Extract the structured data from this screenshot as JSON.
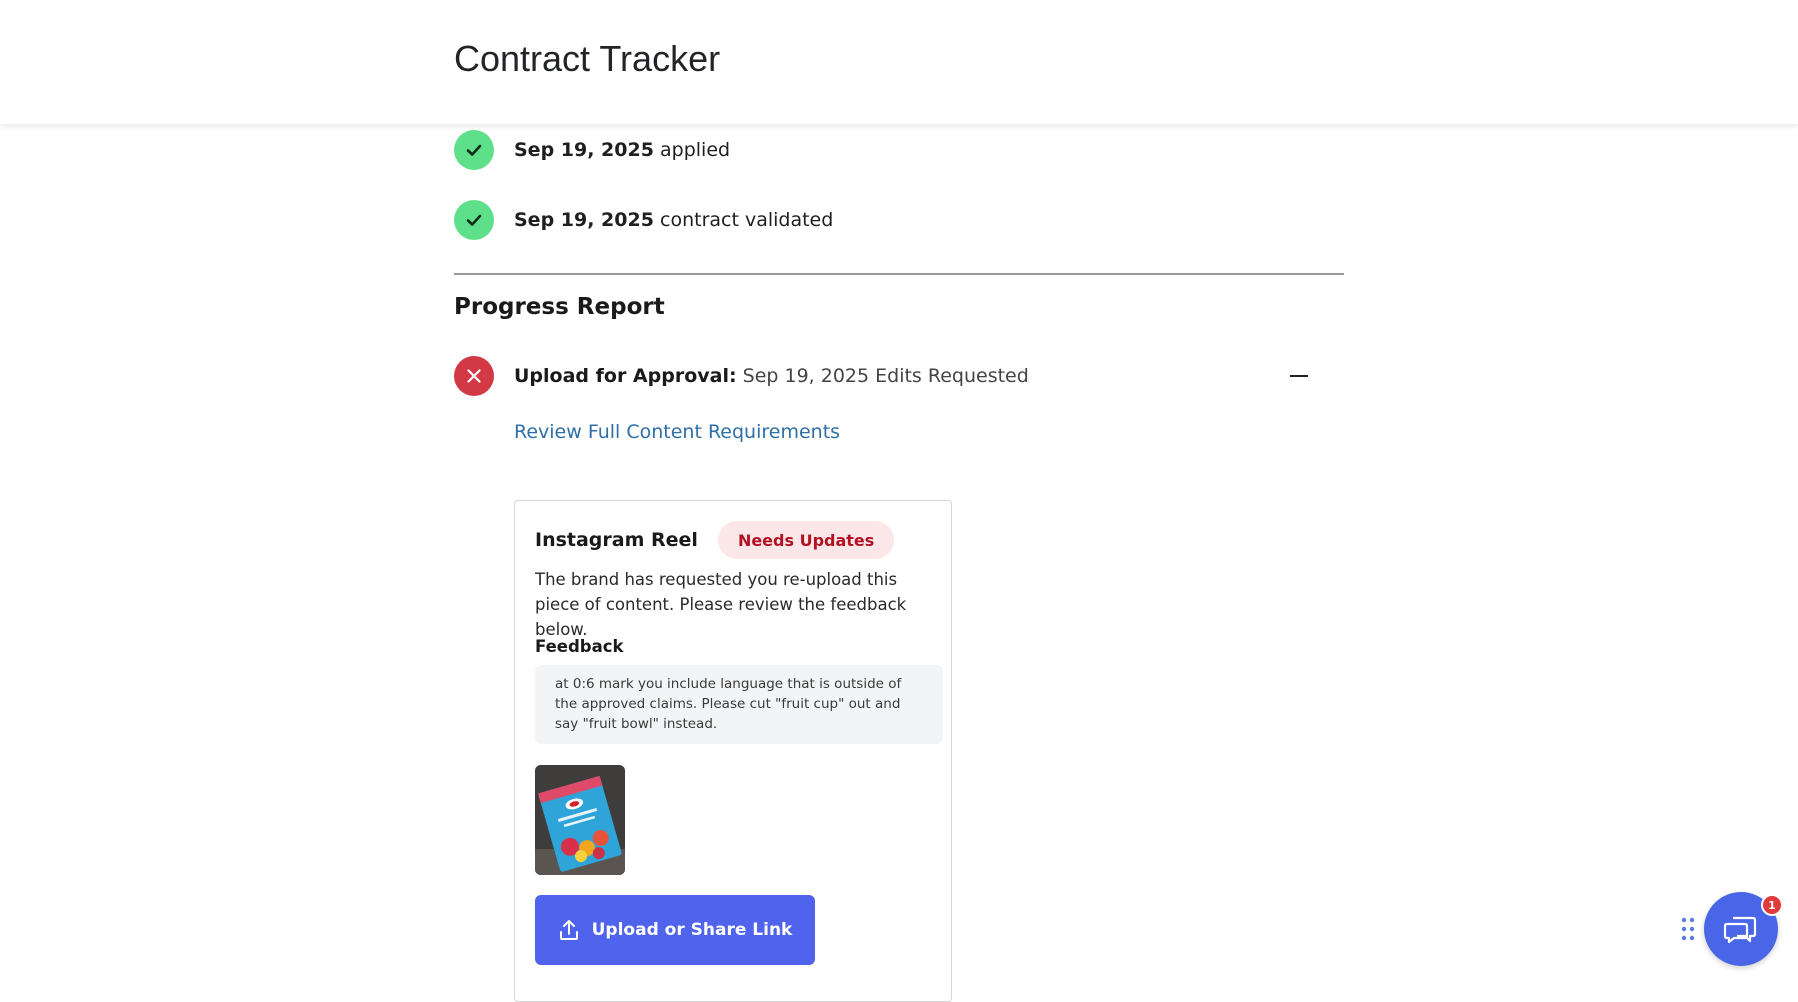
{
  "header": {
    "title": "Contract Tracker"
  },
  "timeline": [
    {
      "date": "Sep 19, 2025",
      "event": "applied"
    },
    {
      "date": "Sep 19, 2025",
      "event": "contract validated"
    }
  ],
  "progress_report": {
    "title": "Progress Report",
    "step": {
      "label": "Upload for Approval:",
      "status": "Sep 19, 2025 Edits Requested",
      "requirements_link": "Review Full Content Requirements"
    },
    "card": {
      "title": "Instagram Reel",
      "badge": "Needs Updates",
      "description": "The brand has requested you re-upload this piece of content. Please review the feedback below.",
      "feedback_label": "Feedback",
      "feedback_text": "at 0:6 mark you include language that is outside of the approved claims. Please cut \"fruit cup\" out and say \"fruit bowl\" instead.",
      "upload_button": "Upload or Share Link"
    }
  },
  "chat": {
    "badge_count": "1"
  },
  "colors": {
    "success": "#5ee08a",
    "error": "#d23945",
    "link": "#2f6fa8",
    "primary": "#4f63ec",
    "badge_bg": "#fbe6e8",
    "badge_text": "#b31225"
  }
}
